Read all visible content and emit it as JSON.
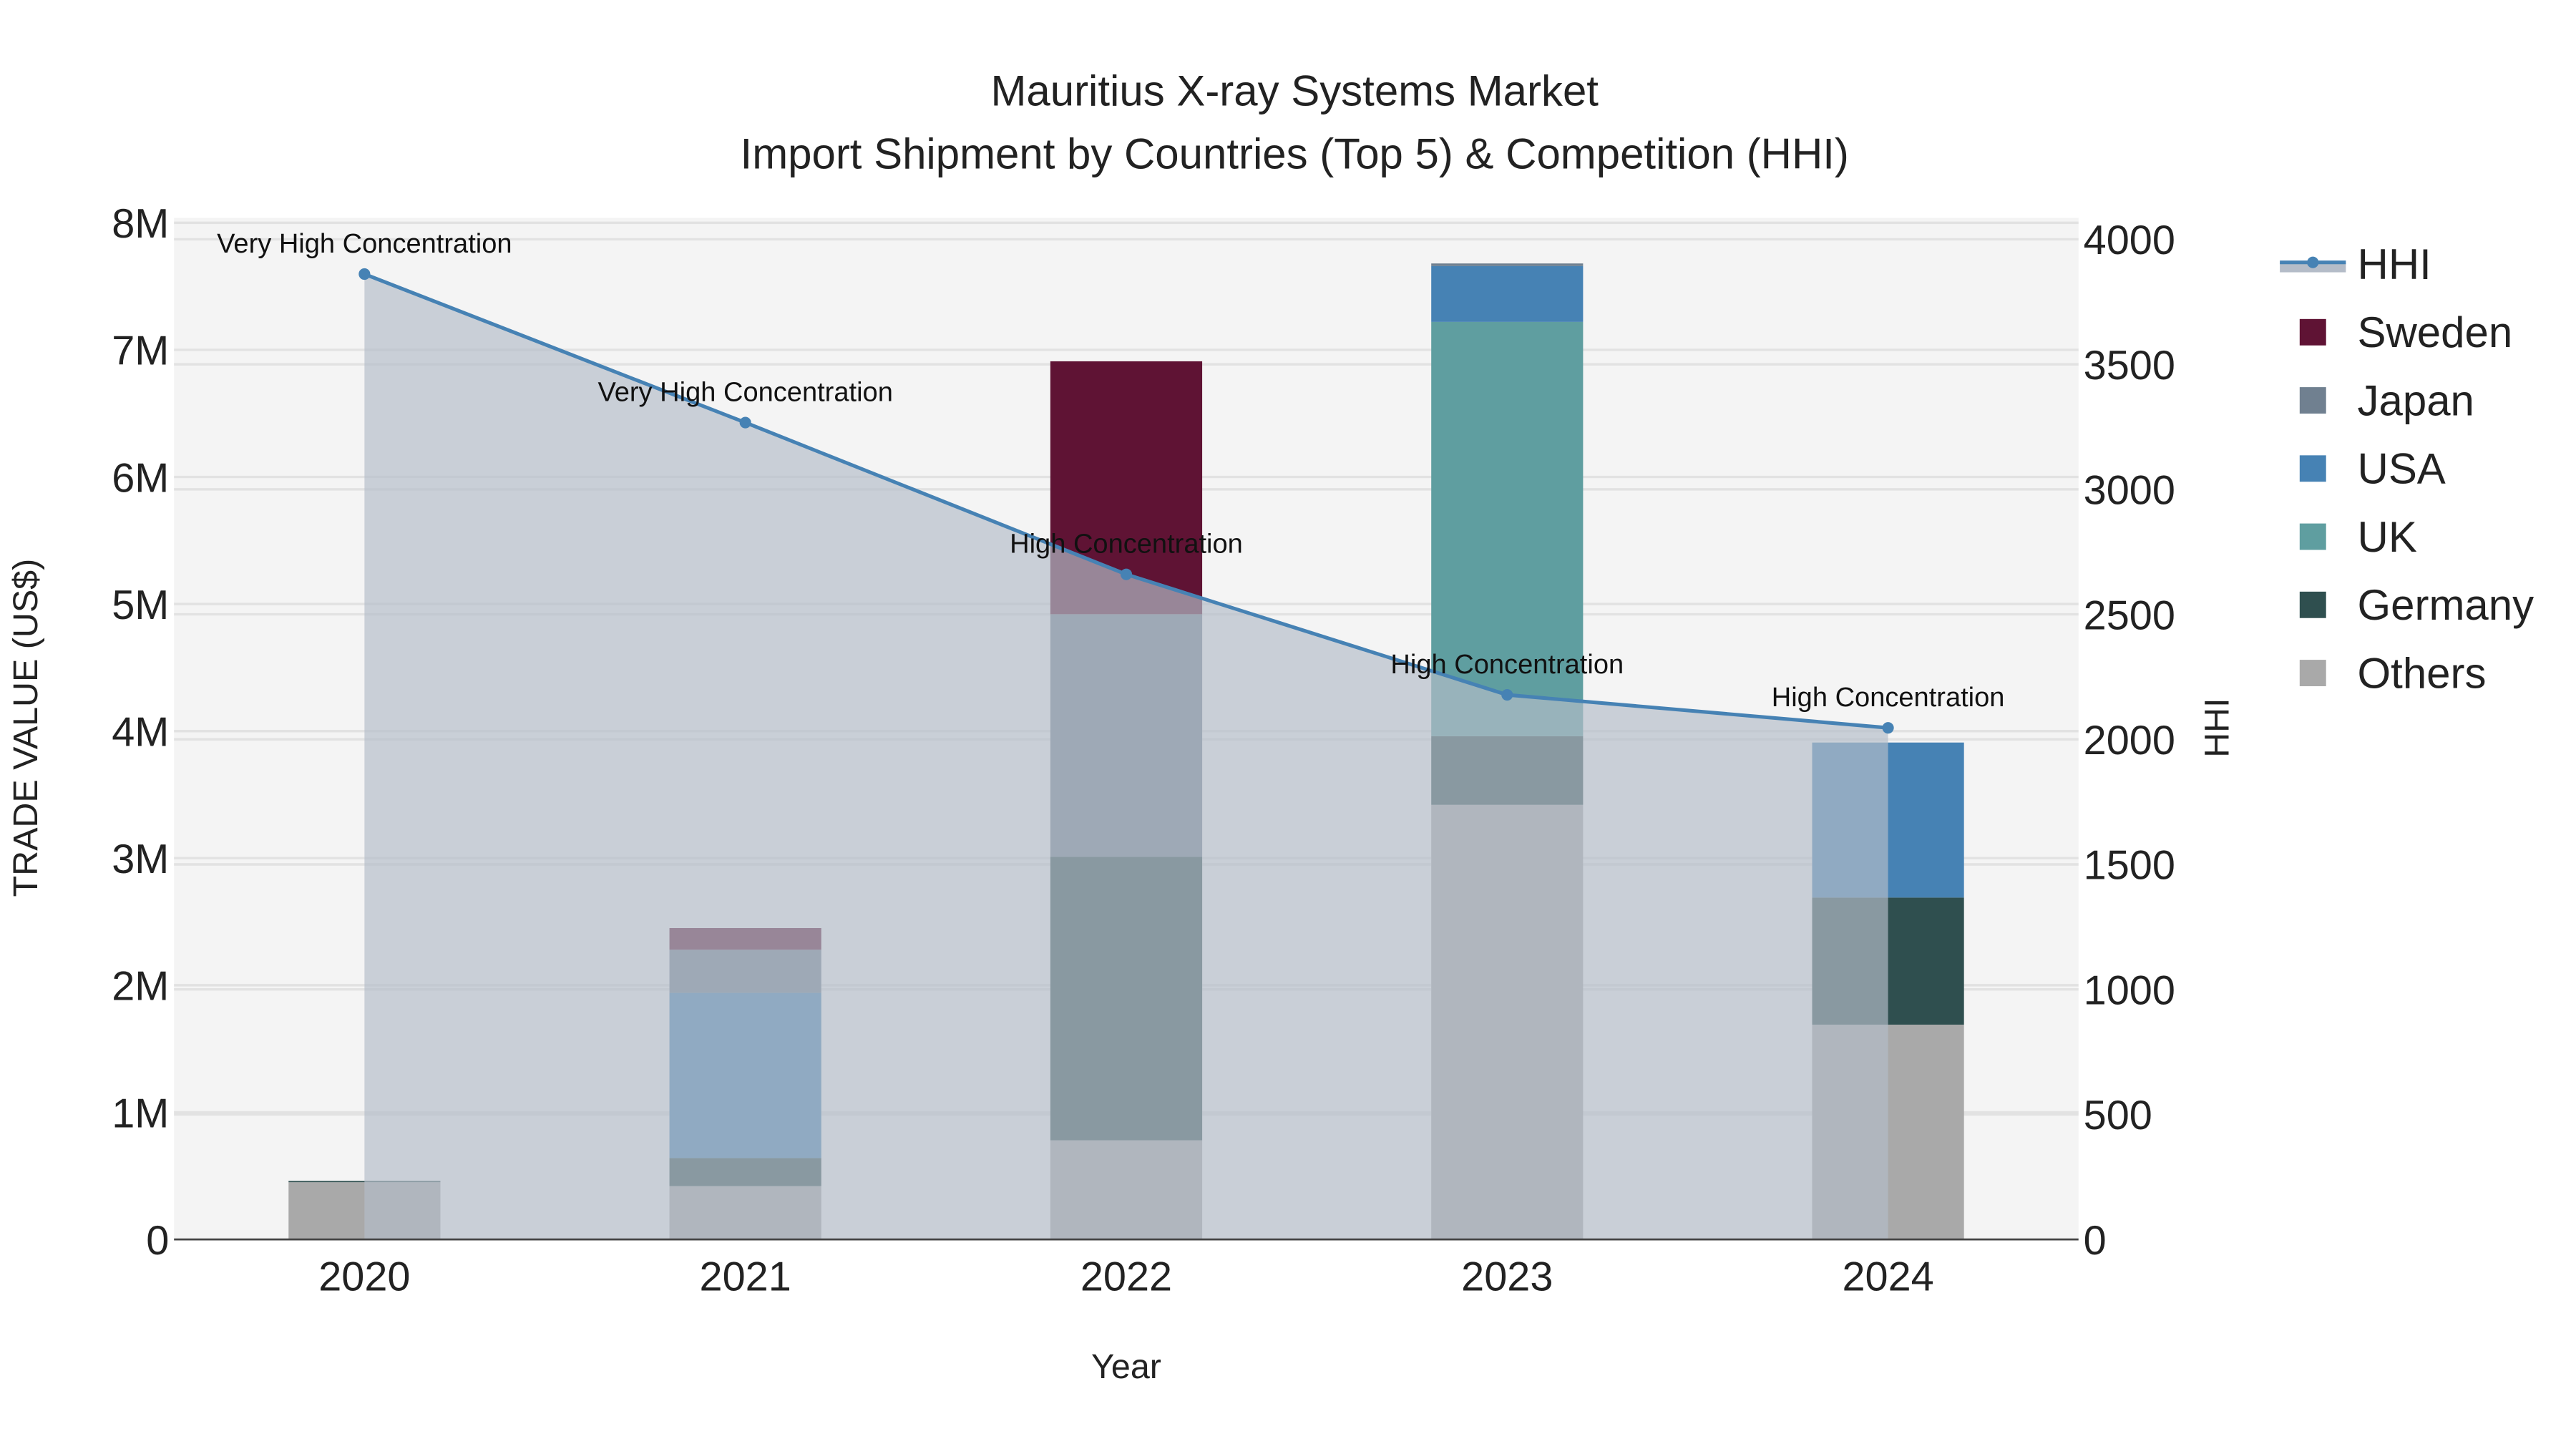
{
  "chart_data": {
    "type": "bar",
    "title_line1": "Mauritius X-ray Systems Market",
    "title_line2": "Import Shipment by Countries (Top 5) & Competition (HHI)",
    "xlabel": "Year",
    "ylabel": "TRADE VALUE (US$)",
    "y2label": "HHI",
    "categories": [
      "2020",
      "2021",
      "2022",
      "2023",
      "2024"
    ],
    "ylim": [
      0,
      8000000
    ],
    "y_ticks": [
      "0",
      "1M",
      "2M",
      "3M",
      "4M",
      "5M",
      "6M",
      "7M",
      "8M"
    ],
    "y2lim": [
      0,
      4000
    ],
    "y2_ticks": [
      "0",
      "500",
      "1000",
      "1500",
      "2000",
      "2500",
      "3000",
      "3500",
      "4000"
    ],
    "grid": true,
    "legend_position": "right",
    "series": [
      {
        "name": "Others",
        "color": "#a9a9a9",
        "values": [
          450000,
          420000,
          780000,
          3420000,
          1690000
        ]
      },
      {
        "name": "Germany",
        "color": "#2f4f4f",
        "values": [
          10000,
          220000,
          2230000,
          540000,
          1000000
        ]
      },
      {
        "name": "UK",
        "color": "#5f9ea0",
        "values": [
          0,
          0,
          0,
          3260000,
          0
        ]
      },
      {
        "name": "USA",
        "color": "#4682b4",
        "values": [
          0,
          1300000,
          0,
          440000,
          1220000
        ]
      },
      {
        "name": "Japan",
        "color": "#708090",
        "values": [
          0,
          340000,
          1910000,
          20000,
          0
        ]
      },
      {
        "name": "Sweden",
        "color": "#5f1334",
        "values": [
          0,
          170000,
          1990000,
          0,
          0
        ]
      }
    ],
    "hhi": {
      "name": "HHI",
      "color": "#4682b4",
      "values": [
        3861,
        3267,
        2660,
        2178,
        2046
      ],
      "labels": [
        "Very High Concentration",
        "Very High Concentration",
        "High Concentration",
        "High Concentration",
        "High Concentration"
      ]
    },
    "legend_order": [
      "HHI",
      "Sweden",
      "Japan",
      "USA",
      "UK",
      "Germany",
      "Others"
    ]
  }
}
